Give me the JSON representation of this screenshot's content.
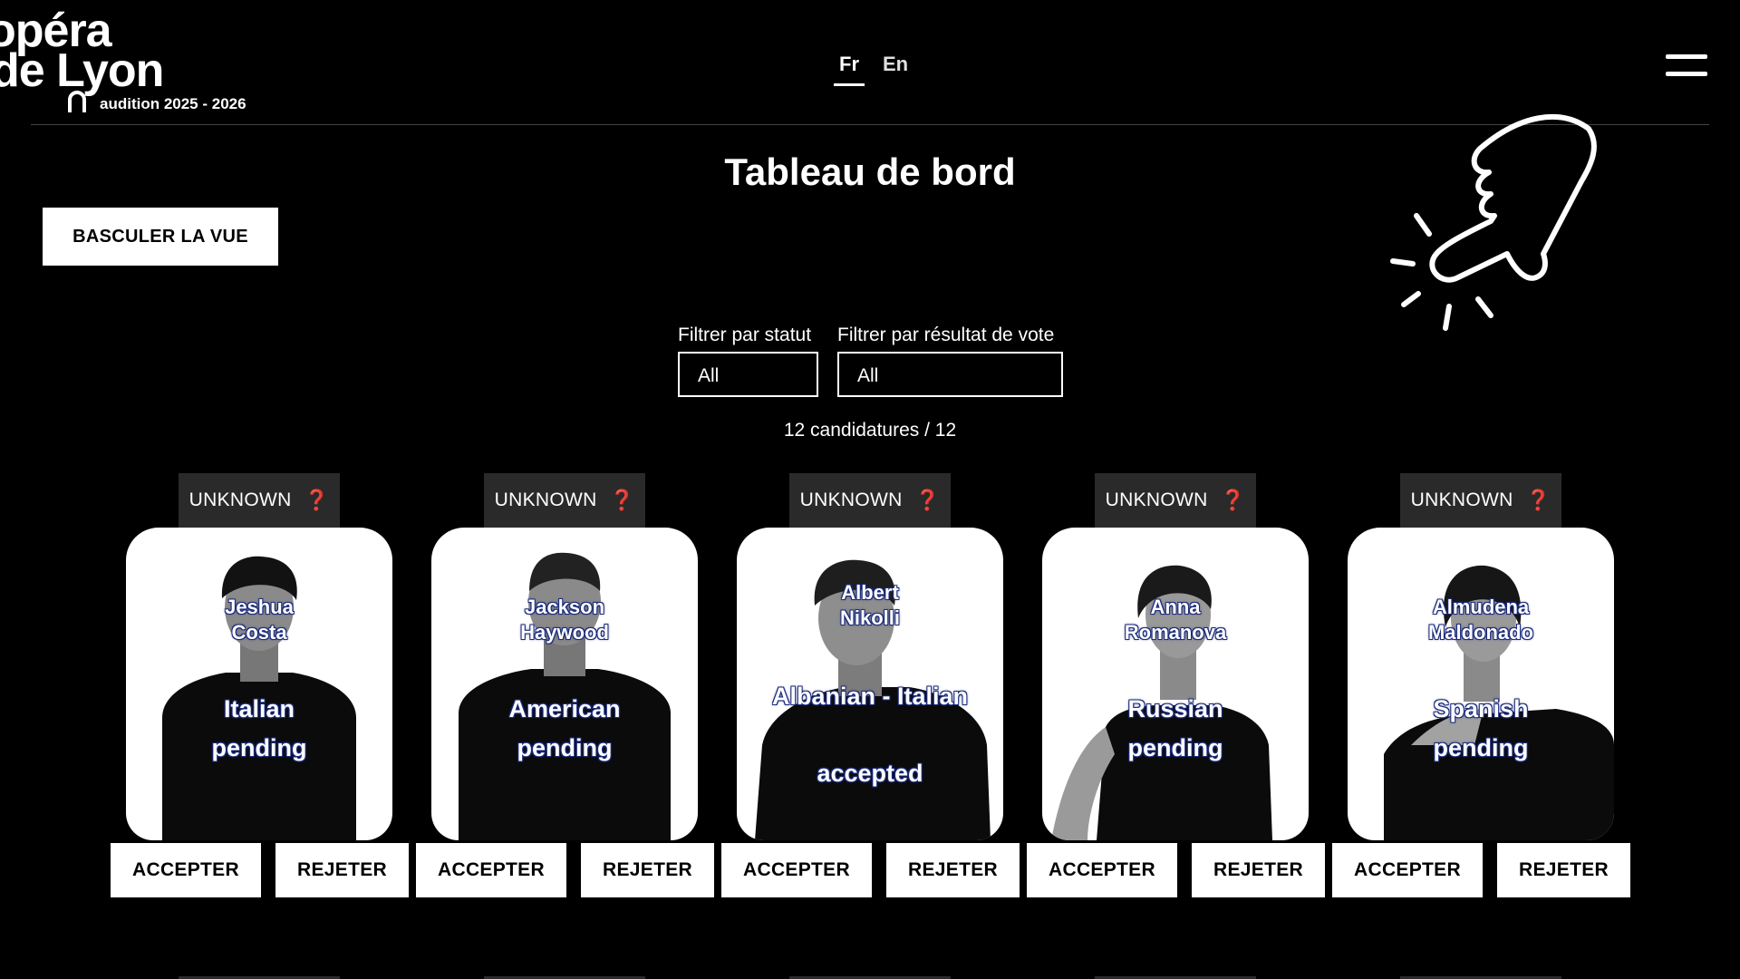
{
  "header": {
    "logo_line1": "opéra",
    "logo_line2": "de Lyon",
    "logo_subtitle": "audition 2025 - 2026",
    "languages": [
      {
        "label": "Fr",
        "active": true
      },
      {
        "label": "En",
        "active": false
      }
    ],
    "menu_icon": "hamburger-menu-icon"
  },
  "page": {
    "title": "Tableau de bord",
    "toggle_view_label": "BASCULER LA VUE",
    "decoration_icon": "pointing-hand-click-icon"
  },
  "filters": {
    "status_label": "Filtrer par statut",
    "status_value": "All",
    "vote_label": "Filtrer par résultat de vote",
    "vote_value": "All"
  },
  "results_count": "12 candidatures / 12",
  "candidates": [
    {
      "vote_badge": "UNKNOWN",
      "badge_icon": "❓",
      "first_name": "Jeshua",
      "last_name": "Costa",
      "nationality": "Italian",
      "status": "pending",
      "accept_label": "ACCEPTER",
      "reject_label": "REJETER"
    },
    {
      "vote_badge": "UNKNOWN",
      "badge_icon": "❓",
      "first_name": "Jackson",
      "last_name": "Haywood",
      "nationality": "American",
      "status": "pending",
      "accept_label": "ACCEPTER",
      "reject_label": "REJETER"
    },
    {
      "vote_badge": "UNKNOWN",
      "badge_icon": "❓",
      "first_name": "Albert",
      "last_name": "Nikolli",
      "nationality": "Albanian - Italian",
      "status": "accepted",
      "accept_label": "ACCEPTER",
      "reject_label": "REJETER"
    },
    {
      "vote_badge": "UNKNOWN",
      "badge_icon": "❓",
      "first_name": "Anna",
      "last_name": "Romanova",
      "nationality": "Russian",
      "status": "pending",
      "accept_label": "ACCEPTER",
      "reject_label": "REJETER"
    },
    {
      "vote_badge": "UNKNOWN",
      "badge_icon": "❓",
      "first_name": "Almudena",
      "last_name": "Maldonado",
      "nationality": "Spanish",
      "status": "pending",
      "accept_label": "ACCEPTER",
      "reject_label": "REJETER"
    }
  ],
  "colors": {
    "background": "#000000",
    "badge_bg": "#2a2a2a",
    "badge_icon": "#d8202a",
    "name_outline": "#1a2a7a"
  }
}
